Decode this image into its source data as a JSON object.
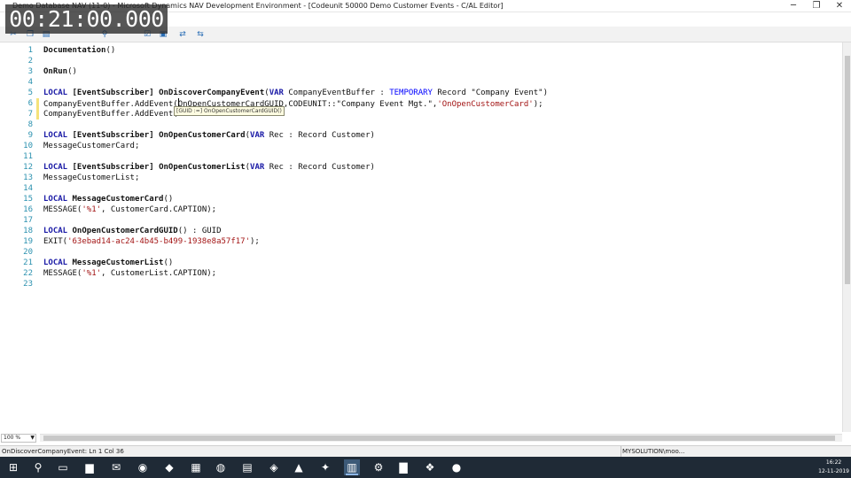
{
  "window": {
    "title": "Demo Database NAV (11-0) - Microsoft Dynamics NAV Development Environment - [Codeunit 50000 Demo Customer Events - C/AL Editor]",
    "minimize": "─",
    "restore": "❐",
    "close": "✕"
  },
  "timer": "00:21:00.000",
  "toolbar": {
    "icons": [
      "scissors-icon",
      "copy-icon",
      "paste-icon",
      "find-icon",
      "compile-icon",
      "run-icon",
      "symbol-menu-icon",
      "debug-icon"
    ]
  },
  "editor": {
    "lines": [
      {
        "n": "1",
        "html": "<span class=\"fn\">Documentation</span>()"
      },
      {
        "n": "2",
        "html": ""
      },
      {
        "n": "3",
        "html": "<span class=\"fn\">OnRun</span>()"
      },
      {
        "n": "4",
        "html": ""
      },
      {
        "n": "5",
        "html": "<span class=\"kw\">LOCAL</span> <span class=\"fn\">[EventSubscriber]</span> <span class=\"fn\">OnDiscoverCompanyEvent</span>(<span class=\"kw\">VAR</span> CompanyEventBuffer : <span class=\"tmp\">TEMPORARY</span> Record \"Company Event\")"
      },
      {
        "n": "6",
        "html": "CompanyEventBuffer.AddEvent(<span class=\"caret\"></span>OnOpenCustomerCardGUID,CODEUNIT::\"Company Event Mgt.\",<span class=\"str\">'OnOpenCustomerCard'</span>);",
        "mark": true
      },
      {
        "n": "7",
        "html": "CompanyEventBuffer.AddEvent(",
        "mark": true
      },
      {
        "n": "8",
        "html": ""
      },
      {
        "n": "9",
        "html": "<span class=\"kw\">LOCAL</span> <span class=\"fn\">[EventSubscriber]</span> <span class=\"fn\">OnOpenCustomerCard</span>(<span class=\"kw\">VAR</span> Rec : Record Customer)"
      },
      {
        "n": "10",
        "html": "MessageCustomerCard;"
      },
      {
        "n": "11",
        "html": ""
      },
      {
        "n": "12",
        "html": "<span class=\"kw\">LOCAL</span> <span class=\"fn\">[EventSubscriber]</span> <span class=\"fn\">OnOpenCustomerList</span>(<span class=\"kw\">VAR</span> Rec : Record Customer)"
      },
      {
        "n": "13",
        "html": "MessageCustomerList;"
      },
      {
        "n": "14",
        "html": ""
      },
      {
        "n": "15",
        "html": "<span class=\"kw\">LOCAL</span> <span class=\"fn\">MessageCustomerCard</span>()"
      },
      {
        "n": "16",
        "html": "MESSAGE(<span class=\"str\">'%1'</span>, CustomerCard.CAPTION);"
      },
      {
        "n": "17",
        "html": ""
      },
      {
        "n": "18",
        "html": "<span class=\"kw\">LOCAL</span> <span class=\"fn\">OnOpenCustomerCardGUID</span>() : GUID"
      },
      {
        "n": "19",
        "html": "EXIT(<span class=\"str\">'63ebad14-ac24-4b45-b499-1938e8a57f17'</span>);"
      },
      {
        "n": "20",
        "html": ""
      },
      {
        "n": "21",
        "html": "<span class=\"kw\">LOCAL</span> <span class=\"fn\">MessageCustomerList</span>()"
      },
      {
        "n": "22",
        "html": "MESSAGE(<span class=\"str\">'%1'</span>, CustomerList.CAPTION);"
      },
      {
        "n": "23",
        "html": ""
      }
    ],
    "tooltip": "[GUID :=] OnOpenCustomerCardGUID()"
  },
  "zoom": "100 %",
  "status": {
    "left": "OnDiscoverCompanyEvent: Ln 1 Col 36",
    "right": "MYSOLUTION\\moo..."
  },
  "taskbar": {
    "items": [
      {
        "name": "start-icon",
        "glyph": "⊞"
      },
      {
        "name": "search-icon",
        "glyph": "⚲"
      },
      {
        "name": "task-view-icon",
        "glyph": "▭"
      },
      {
        "name": "file-explorer-icon",
        "glyph": "▆"
      },
      {
        "name": "outlook-icon",
        "glyph": "✉"
      },
      {
        "name": "chrome-icon",
        "glyph": "◉"
      },
      {
        "name": "app-icon",
        "glyph": "◆"
      },
      {
        "name": "excel-icon",
        "glyph": "▦"
      },
      {
        "name": "chat-icon",
        "glyph": "◍"
      },
      {
        "name": "app-icon",
        "glyph": "▤"
      },
      {
        "name": "visual-studio-icon",
        "glyph": "◈"
      },
      {
        "name": "azure-icon",
        "glyph": "▲"
      },
      {
        "name": "vscode-icon",
        "glyph": "✦"
      },
      {
        "name": "nav-dev-env-icon",
        "glyph": "▥"
      },
      {
        "name": "settings-icon",
        "glyph": "⚙"
      },
      {
        "name": "chart-app-icon",
        "glyph": "▇"
      },
      {
        "name": "app-icon",
        "glyph": "❖"
      },
      {
        "name": "powerpoint-icon",
        "glyph": "●"
      }
    ],
    "time": "16:22",
    "date": "12-11-2019"
  }
}
